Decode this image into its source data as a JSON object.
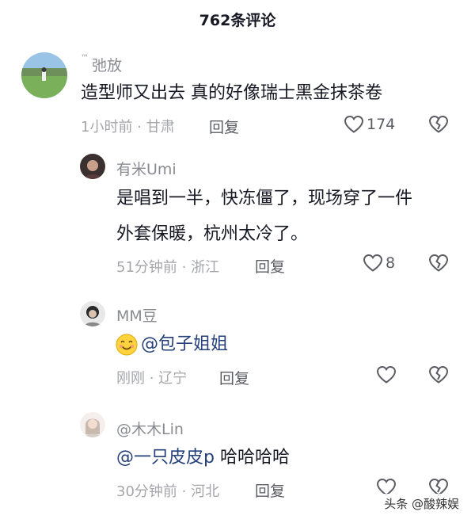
{
  "header": {
    "title": "762条评论"
  },
  "comments": [
    {
      "name": "弛放",
      "name_prefix": "™",
      "text": "造型师又出去 真的好像瑞士黑金抹茶卷",
      "meta": "1小时前 · 甘肃",
      "reply_label": "回复",
      "likes": "174"
    },
    {
      "name": "有米Umi",
      "text_line1": "是唱到一半，快冻僵了，现场穿了一件",
      "text_line2": "外套保暖，杭州太冷了。",
      "meta": "51分钟前 · 浙江",
      "reply_label": "回复",
      "likes": "8"
    },
    {
      "name": "MM豆",
      "mention": "@包子姐姐",
      "meta": "刚刚 · 辽宁",
      "reply_label": "回复"
    },
    {
      "name": "@木木Lin",
      "mention": "@一只皮皮p",
      "text": " 哈哈哈哈",
      "meta": "30分钟前 · 河北",
      "reply_label": "回复"
    }
  ],
  "watermark": "头条 @酸辣娱",
  "icons": {
    "like": "heart-outline-icon",
    "dislike": "broken-heart-icon",
    "emoji": "smiling-face-emoji"
  },
  "colors": {
    "mention": "#25407a",
    "meta": "#a5a6ab",
    "name": "#8a8b91"
  }
}
